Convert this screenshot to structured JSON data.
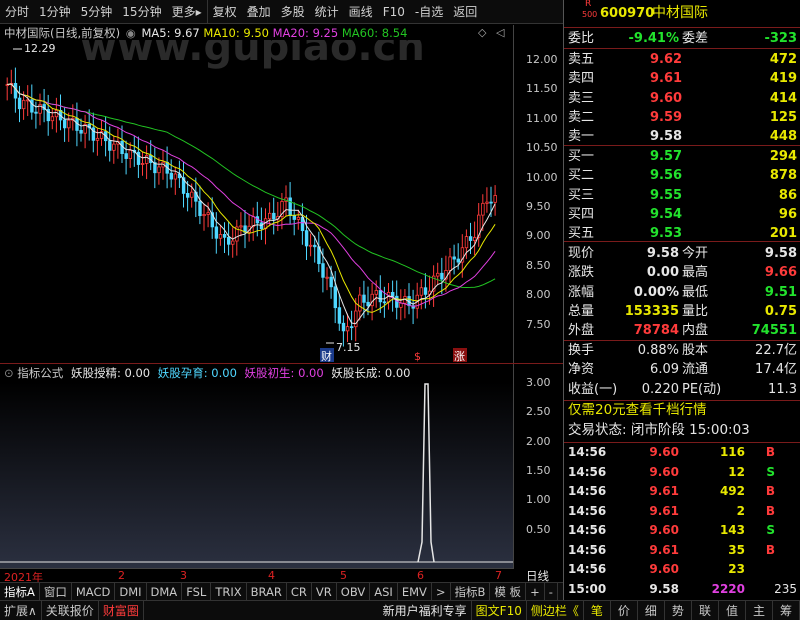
{
  "toolbar": {
    "items": [
      "分时",
      "1分钟",
      "5分钟",
      "15分钟",
      "更多",
      "复权",
      "叠加",
      "多股",
      "统计",
      "画线",
      "F10",
      "-自选",
      "返回"
    ]
  },
  "chart": {
    "title": "中材国际(日线,前复权)",
    "ma5_label": "MA5: 9.67",
    "ma10_label": "MA10: 9.50",
    "ma20_label": "MA20: 9.25",
    "ma60_label": "MA60: 8.54",
    "high_label": "12.29",
    "low_label": "7.15",
    "marker_cai": "财",
    "marker_s": "$",
    "marker_zhang": "涨",
    "watermark": "www.gupiao.cn"
  },
  "price_axis": [
    "12.00",
    "11.50",
    "11.00",
    "10.50",
    "10.00",
    "9.50",
    "9.00",
    "8.50",
    "8.00",
    "7.50"
  ],
  "indicator": {
    "title": "指标公式",
    "items": [
      {
        "label": "妖股授精: 0.00",
        "color": "#e6e6e6"
      },
      {
        "label": "妖股孕育: 0.00",
        "color": "#4fd7ff"
      },
      {
        "label": "妖股初生: 0.00",
        "color": "#e040e0"
      },
      {
        "label": "妖股长成: 0.00",
        "color": "#e6e6e6"
      }
    ],
    "axis": [
      "3.00",
      "2.50",
      "2.00",
      "1.50",
      "1.00",
      "0.50"
    ]
  },
  "date_axis": [
    "2021年",
    "2",
    "3",
    "4",
    "5",
    "6",
    "7"
  ],
  "bottom_tabs": [
    "指标A",
    "窗口",
    "MACD",
    "DMI",
    "DMA",
    "FSL",
    "TRIX",
    "BRAR",
    "CR",
    "VR",
    "OBV",
    "ASI",
    "EMV",
    ">",
    "指标B",
    "模 板",
    "+",
    "-",
    "日线"
  ],
  "status_bar": {
    "left": [
      "扩展∧",
      "关联报价",
      "财富圈"
    ],
    "middle": "新用户福利专享",
    "right_a": "图文F10",
    "right_b": "侧边栏《",
    "tabs": [
      "笔",
      "价",
      "细",
      "势",
      "联",
      "值",
      "主",
      "筹"
    ]
  },
  "quote": {
    "r_label": "R",
    "r_sub": "500",
    "code": "600970",
    "name": "中材国际",
    "weibi_label": "委比",
    "weibi_value": "-9.41%",
    "weicha_label": "委差",
    "weicha_value": "-323",
    "asks": [
      {
        "label": "卖五",
        "price": "9.62",
        "vol": "472"
      },
      {
        "label": "卖四",
        "price": "9.61",
        "vol": "419"
      },
      {
        "label": "卖三",
        "price": "9.60",
        "vol": "414"
      },
      {
        "label": "卖二",
        "price": "9.59",
        "vol": "125"
      },
      {
        "label": "卖一",
        "price": "9.58",
        "vol": "448"
      }
    ],
    "bids": [
      {
        "label": "买一",
        "price": "9.57",
        "vol": "294"
      },
      {
        "label": "买二",
        "price": "9.56",
        "vol": "878"
      },
      {
        "label": "买三",
        "price": "9.55",
        "vol": "86"
      },
      {
        "label": "买四",
        "price": "9.54",
        "vol": "96"
      },
      {
        "label": "买五",
        "price": "9.53",
        "vol": "201"
      }
    ],
    "stats": [
      {
        "l1": "现价",
        "v1": "9.58",
        "l2": "今开",
        "v2": "9.58",
        "c1": "white",
        "c2": "white"
      },
      {
        "l1": "涨跌",
        "v1": "0.00",
        "l2": "最高",
        "v2": "9.66",
        "c1": "white",
        "c2": "red"
      },
      {
        "l1": "涨幅",
        "v1": "0.00%",
        "l2": "最低",
        "v2": "9.51",
        "c1": "white",
        "c2": "green"
      },
      {
        "l1": "总量",
        "v1": "153335",
        "l2": "量比",
        "v2": "0.75",
        "c1": "yellow",
        "c2": "yellow"
      },
      {
        "l1": "外盘",
        "v1": "78784",
        "l2": "内盘",
        "v2": "74551",
        "c1": "red",
        "c2": "green"
      }
    ],
    "fund": [
      {
        "l1": "换手",
        "v1": "0.88%",
        "l2": "股本",
        "v2": "22.7亿"
      },
      {
        "l1": "净资",
        "v1": "6.09",
        "l2": "流通",
        "v2": "17.4亿"
      },
      {
        "l1": "收益(一)",
        "v1": "0.220",
        "l2": "PE(动)",
        "v2": "11.3"
      }
    ],
    "promo": "仅需20元查看千档行情",
    "trade_state": "交易状态: 闭市阶段 15:00:03",
    "ticks": [
      {
        "time": "14:56",
        "price": "9.60",
        "vol": "116",
        "bs": "B"
      },
      {
        "time": "14:56",
        "price": "9.60",
        "vol": "12",
        "bs": "S"
      },
      {
        "time": "14:56",
        "price": "9.61",
        "vol": "492",
        "bs": "B"
      },
      {
        "time": "14:56",
        "price": "9.61",
        "vol": "2",
        "bs": "B"
      },
      {
        "time": "14:56",
        "price": "9.60",
        "vol": "143",
        "bs": "S"
      },
      {
        "time": "14:56",
        "price": "9.61",
        "vol": "35",
        "bs": "B"
      },
      {
        "time": "14:56",
        "price": "9.60",
        "vol": "23",
        "bs": ""
      },
      {
        "time": "15:00",
        "price": "9.58",
        "vol": "2220",
        "bs": "235"
      }
    ]
  },
  "colors": {
    "up": "#ff3b3b",
    "down": "#22e32d",
    "ma5": "#e6e6e6",
    "ma10": "#e8e800",
    "ma20": "#e040e0",
    "ma60": "#22c322"
  }
}
